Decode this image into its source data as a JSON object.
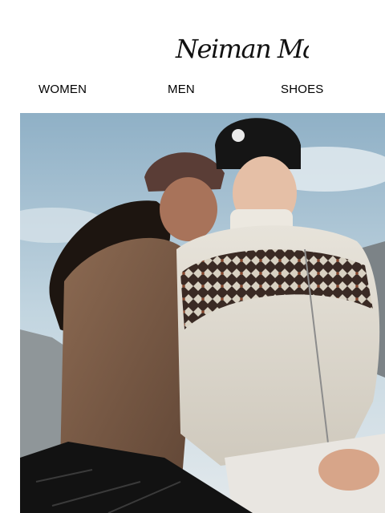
{
  "brand": {
    "logo_text": "Neiman Marcus"
  },
  "nav": {
    "items": [
      {
        "label": "WOMEN"
      },
      {
        "label": "MEN"
      },
      {
        "label": "SHOES"
      }
    ]
  },
  "hero": {
    "image_subject": "couple-in-winter-fleece-jackets",
    "colors": {
      "sky": "#b9cfdc",
      "rock": "#8f9699"
    }
  }
}
